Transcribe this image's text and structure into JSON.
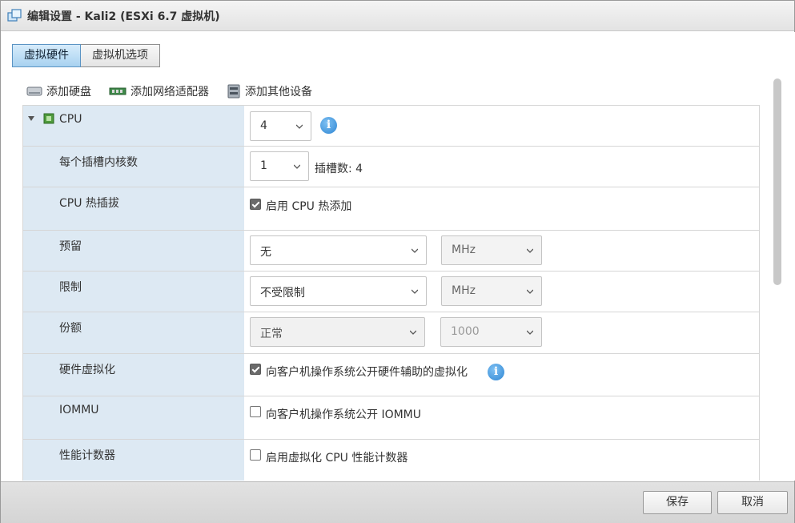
{
  "window": {
    "title": "编辑设置 - Kali2 (ESXi 6.7 虚拟机)"
  },
  "tabs": [
    {
      "label": "虚拟硬件",
      "active": true
    },
    {
      "label": "虚拟机选项",
      "active": false
    }
  ],
  "toolbar": {
    "add_disk": "添加硬盘",
    "add_nic": "添加网络适配器",
    "add_other": "添加其他设备"
  },
  "rows": {
    "cpu": {
      "label": "CPU",
      "value": "4"
    },
    "cores": {
      "label": "每个插槽内核数",
      "value": "1",
      "note": "插槽数: 4"
    },
    "hotplug": {
      "label": "CPU 热插拔",
      "checkbox": "启用 CPU 热添加",
      "checked": true
    },
    "reservation": {
      "label": "预留",
      "value": "无",
      "unit": "MHz"
    },
    "limit": {
      "label": "限制",
      "value": "不受限制",
      "unit": "MHz"
    },
    "shares": {
      "label": "份额",
      "value": "正常",
      "number": "1000"
    },
    "hwvirt": {
      "label": "硬件虚拟化",
      "checkbox": "向客户机操作系统公开硬件辅助的虚拟化",
      "checked": true
    },
    "iommu": {
      "label": "IOMMU",
      "checkbox": "向客户机操作系统公开 IOMMU",
      "checked": false
    },
    "perfcounters": {
      "label": "性能计数器",
      "checkbox": "启用虚拟化 CPU 性能计数器",
      "checked": false
    }
  },
  "info_glyph": "i",
  "footer": {
    "save": "保存",
    "cancel": "取消"
  },
  "colors": {
    "label_bg": "#dde9f3",
    "active_tab": "#a8d2f0",
    "info": "#2f86d3"
  }
}
